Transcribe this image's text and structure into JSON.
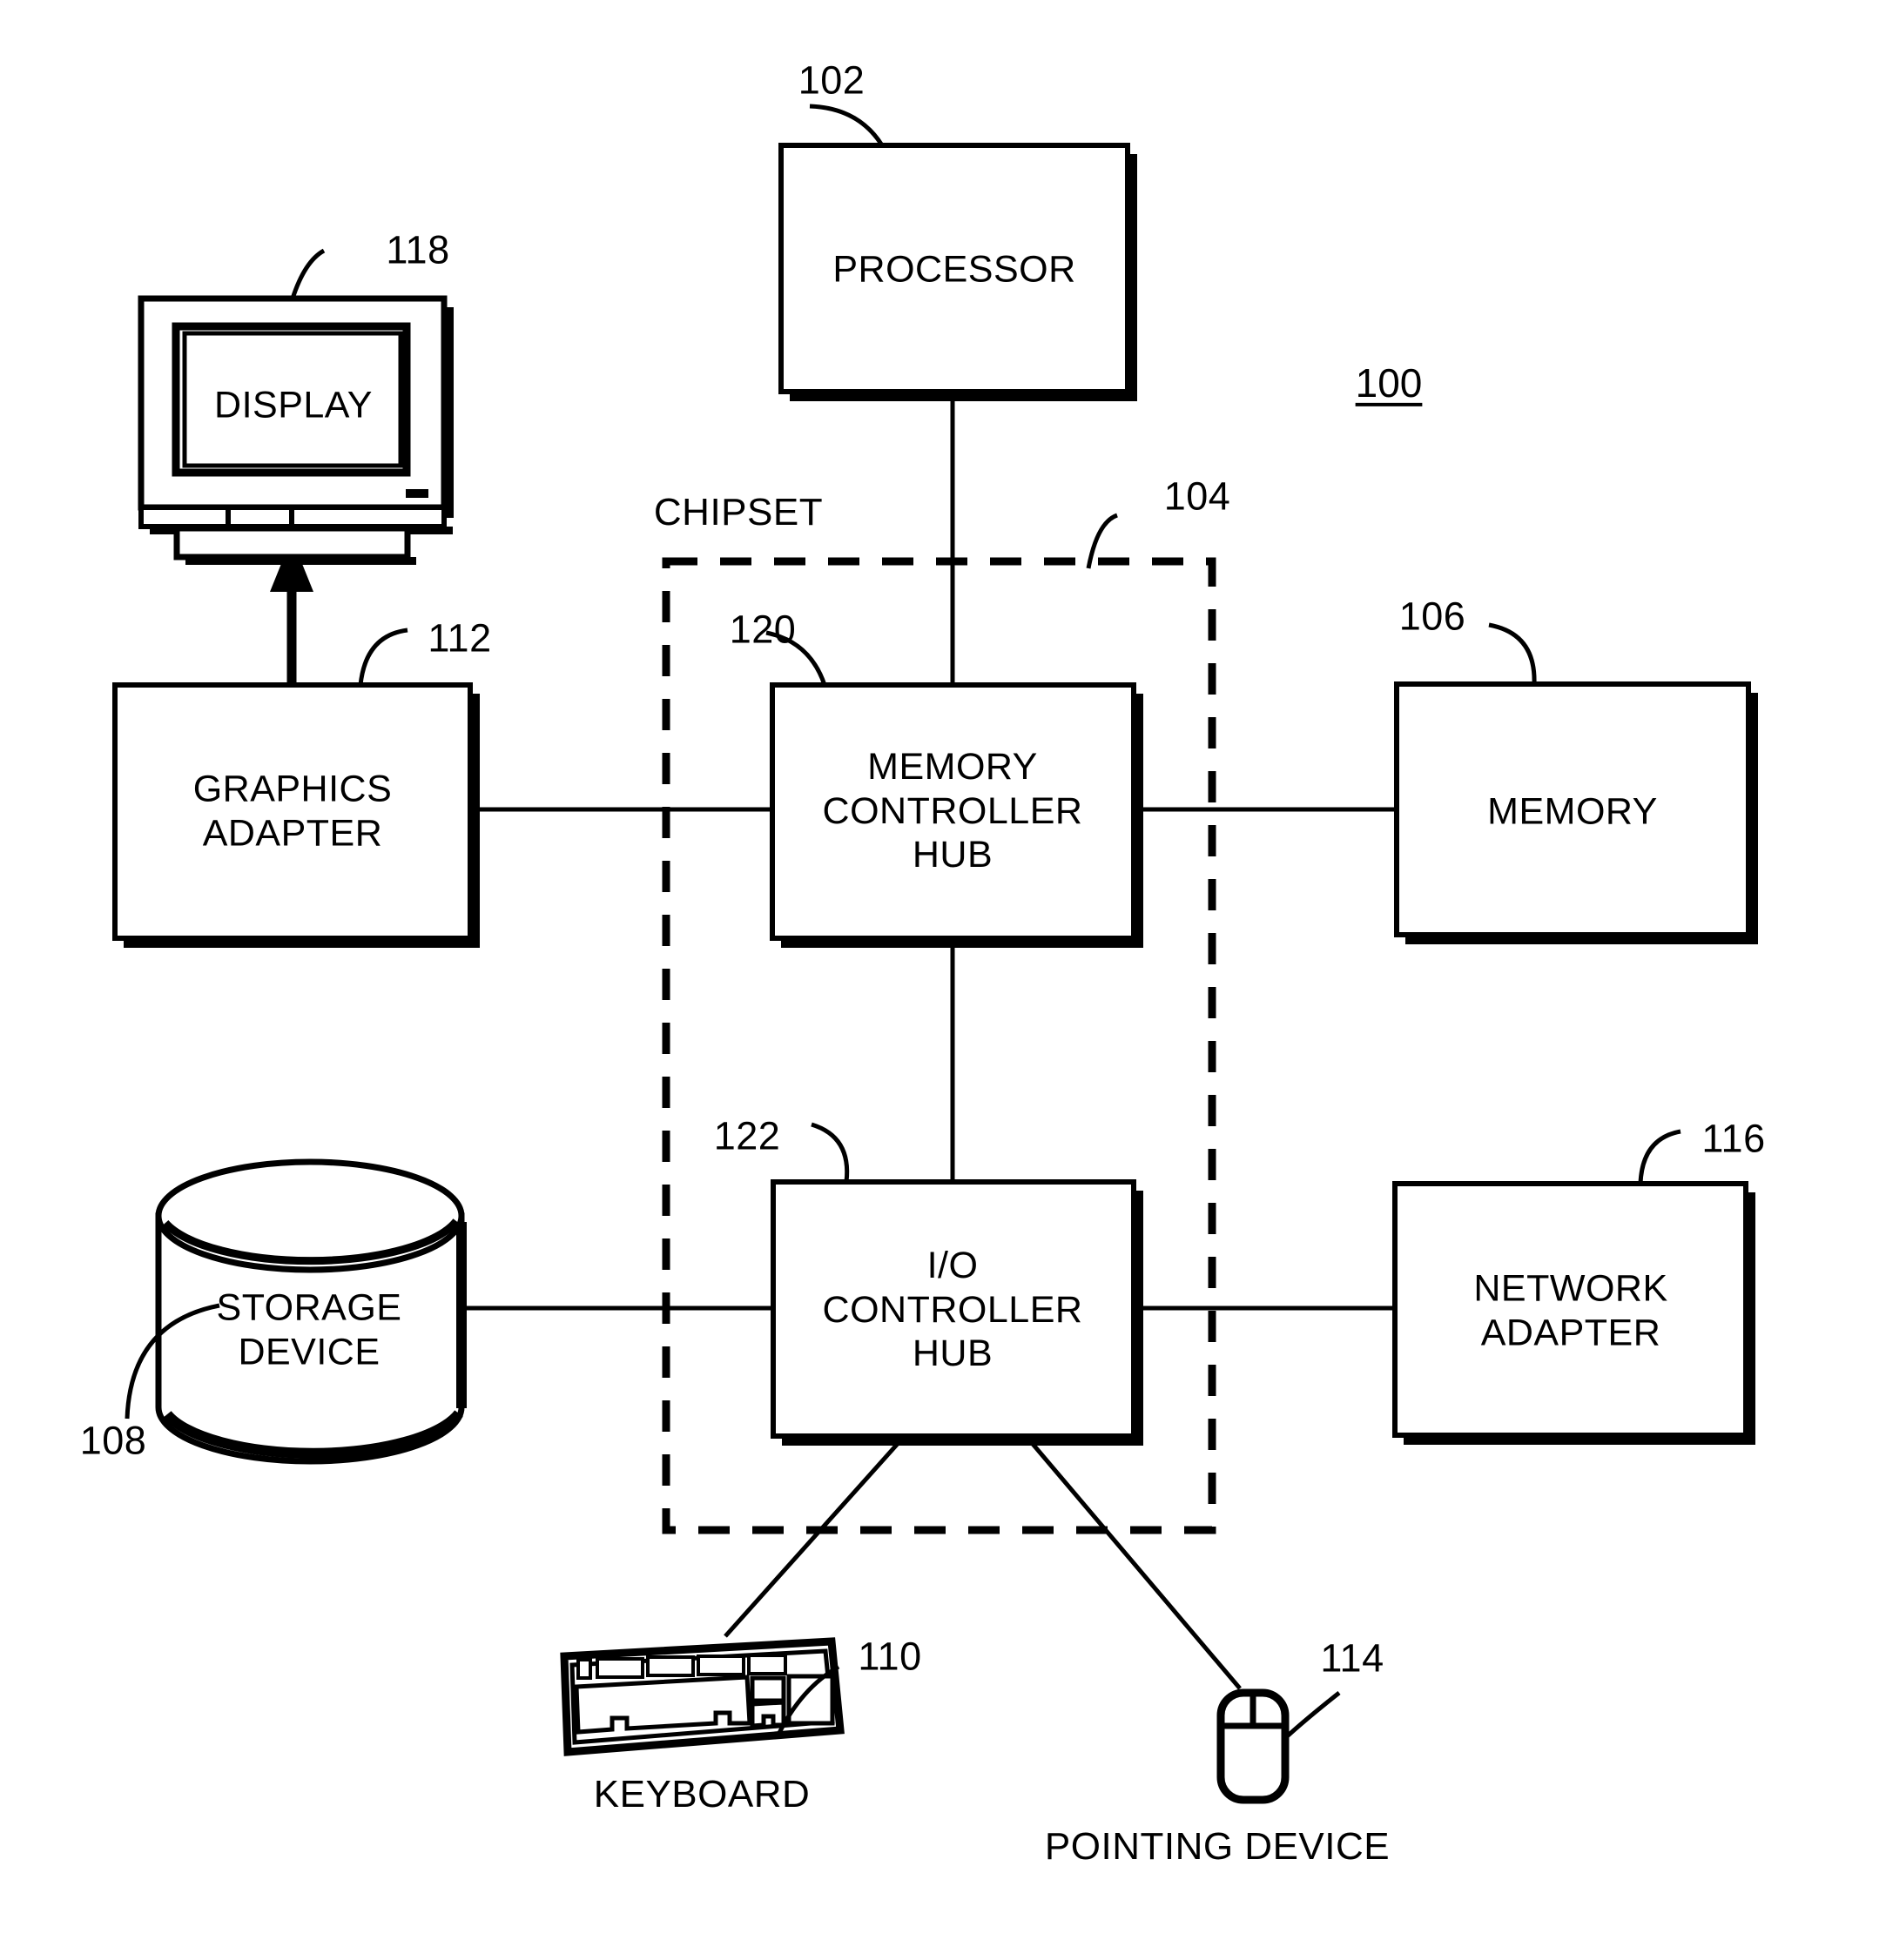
{
  "figure": {
    "number": "100",
    "type": "patent-block-diagram",
    "title_absent": true
  },
  "blocks": [
    {
      "id": "processor",
      "label": "PROCESSOR",
      "ref": "102",
      "shape": "rect"
    },
    {
      "id": "memory-controller-hub",
      "label": "MEMORY\nCONTROLLER\nHUB",
      "ref": "120",
      "shape": "rect"
    },
    {
      "id": "io-controller-hub",
      "label": "I/O\nCONTROLLER\nHUB",
      "ref": "122",
      "shape": "rect"
    },
    {
      "id": "memory",
      "label": "MEMORY",
      "ref": "106",
      "shape": "rect"
    },
    {
      "id": "graphics-adapter",
      "label": "GRAPHICS\nADAPTER",
      "ref": "112",
      "shape": "rect"
    },
    {
      "id": "network-adapter",
      "label": "NETWORK\nADAPTER",
      "ref": "116",
      "shape": "rect"
    },
    {
      "id": "storage-device",
      "label": "STORAGE\nDEVICE",
      "ref": "108",
      "shape": "cylinder"
    },
    {
      "id": "display",
      "label": "DISPLAY",
      "ref": "118",
      "shape": "monitor-icon"
    },
    {
      "id": "keyboard",
      "label": "KEYBOARD",
      "ref": "110",
      "shape": "keyboard-icon"
    },
    {
      "id": "pointing-device",
      "label": "POINTING DEVICE",
      "ref": "114",
      "shape": "mouse-icon"
    }
  ],
  "groups": [
    {
      "id": "chipset",
      "label": "CHIPSET",
      "ref": "104",
      "style": "dashed-border",
      "contains": [
        "memory-controller-hub",
        "io-controller-hub"
      ]
    }
  ],
  "connections": [
    {
      "from": "processor",
      "to": "memory-controller-hub",
      "style": "line"
    },
    {
      "from": "graphics-adapter",
      "to": "memory-controller-hub",
      "style": "line"
    },
    {
      "from": "memory-controller-hub",
      "to": "memory",
      "style": "line"
    },
    {
      "from": "memory-controller-hub",
      "to": "io-controller-hub",
      "style": "line"
    },
    {
      "from": "graphics-adapter",
      "to": "display",
      "style": "arrow"
    },
    {
      "from": "storage-device",
      "to": "io-controller-hub",
      "style": "line"
    },
    {
      "from": "io-controller-hub",
      "to": "network-adapter",
      "style": "line"
    },
    {
      "from": "io-controller-hub",
      "to": "keyboard",
      "style": "line"
    },
    {
      "from": "io-controller-hub",
      "to": "pointing-device",
      "style": "line"
    }
  ],
  "colors": {
    "ink": "#000000",
    "paper": "#ffffff"
  }
}
